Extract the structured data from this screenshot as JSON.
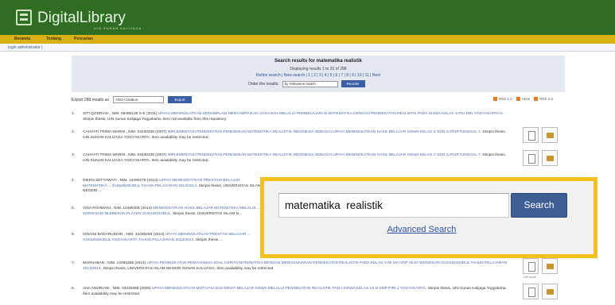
{
  "app": {
    "logo_text": "DigitalLibrary",
    "logo_subtitle": "UIN SUNAN KALIJAGA"
  },
  "menu": {
    "items": [
      "Beranda",
      "Tentang",
      "Pencarian"
    ]
  },
  "login": {
    "label": "login administrator |"
  },
  "results": {
    "title": "Search results for matematika realistik",
    "displaying": "Displaying results 1 to 20 of 288",
    "pagination": "Refine search | New search | 1 | 2 | 3 | 4 | 5 | 6 | 7 | 8 | 9 | 10 | 11 | Next",
    "order_label": "Order the results:",
    "order_value": "by relevance match",
    "reorder_button": "Reorder"
  },
  "export": {
    "label": "Export 288 results as",
    "format": "ASCII Citation",
    "button": "Export",
    "feeds": [
      "RSS 1.0",
      "Atom",
      "RSS 2.0"
    ]
  },
  "rows": [
    {
      "num": "1.",
      "author": "SITI QODRIAH , NIM. 08480126 S-E (2011)",
      "title": "UPAYA MENINGKATKAN KEMAMPUAN MENYAMPAIKAN GAGASAN MELALUI PEMBELAJARAN MATEMATIKA DENGAN PENDEKATAN REALISTIK PADA SISWA KELAS SATU MIN YOGYAKARTA II.",
      "meta": "Skripsi thesis, UIN Sunan Kalijaga Yogyakarta. Item not available from this repository."
    },
    {
      "num": "2.",
      "author": "CAHYATI TRIMA WARNI , NIM. 03430338 (2007)",
      "title": "IMPLEMENTASI PENDEKATAN PENDIDIKAN MATEMATIKA REALISTIK INDONESIA SEBAGAI UPAYA MENINGKATKAN HASIL BELAJAR SISWA KELAS V SDN CATURTUNGGAL 7.",
      "meta": "Skripsi thesis, UIN SUNAN KALIJAGA YOGYAKARTA. Item availability may be restricted."
    },
    {
      "num": "3.",
      "author": "CAHYATI TRIMA WARNI , NIM. 03430338 (2007)",
      "title": "IMPLEMENTASI PENDEKATAN PENDIDIKAN MATEMATIKA REALISTIK INDONESIA SEBAGAI UPAYA MENINGKATKAN HASIL BELAJAR SISWA KELAS V SDN CATURTUNGGAL 7.",
      "meta": "Skripsi thesis, UIN SUNAN KALIJAGA YOGYAKARTA. Item availability may be restricted."
    },
    {
      "num": "4.",
      "author": "NIKEN SETYAWATI , NIM. 13490275 (2014)",
      "title": "UPAYA MENINGKATKAN PRESTASI BELAJAR MATEMATIKA ... GUNUNGKIDUL TAHUN PELAJARAN 2013/2014.",
      "meta": "Skripsi thesis, UNIVERSITAS ISLAM NEGERI ..."
    },
    {
      "num": "5.",
      "author": "VINA ROHMANI , NIM. 13495306 (2014)",
      "title": "MENINGKATKAN HASIL BELAJAR MATEMATIKA MELALUI ... WONOSARI BLEBERAN PLAYEN GUNUNGKIDUL.",
      "meta": "Skripsi thesis, UNIVERSITAS ISLAM N..."
    },
    {
      "num": "6.",
      "author": "ISNAINI BADARUDDIN , NIM. 13495258 (2014)",
      "title": "UPAYA MENINGKATKAN PRESTASI BELAJAR ... GUNUNGKIDUL YOGYAKARTA TAHUN PELAJARAN 2013/2014.",
      "meta": "Skripsi thesis, ..."
    },
    {
      "num": "7.",
      "author": "MARHABAN , NIM. 13495268 (2014)",
      "title": "UPAYA PENINGKATAN PEMAHAMAN SOAL CERITA MATEMATIKA DENGAN MENGGUNAKAN PENDEKATAN REALISTIK PADA KELAS V MI MA'ARIF MIJO WONOSARI GUNUNGKIDUL TAHUN PELAJARAN 2013/2014.",
      "meta": "Skripsi thesis, UNIVERSITAS ISLAM NEGERI SUNAN KALIJAGA. Item availability may be restricted."
    },
    {
      "num": "8.",
      "author": "ANA ANDRIANI , NIM. 03430366 (2008)",
      "title": "UPAYA MENINGKATKAN MOTIVASI DAN MINAT BELAJAR SISWA MELALUI PENDEKATAN REALISTIK PADA SISWA KELAS VII D SMP PIRI 1 YOGYAKARTA.",
      "meta": "Skripsi thesis, UIN Sunan Kalijaga Yogyakarta. Item availability may be restricted."
    }
  ],
  "thumb_caption": "+26 more",
  "callout": {
    "search_value": "matematika  realistik",
    "search_button": "Search",
    "advanced_link": "Advanced Search"
  }
}
